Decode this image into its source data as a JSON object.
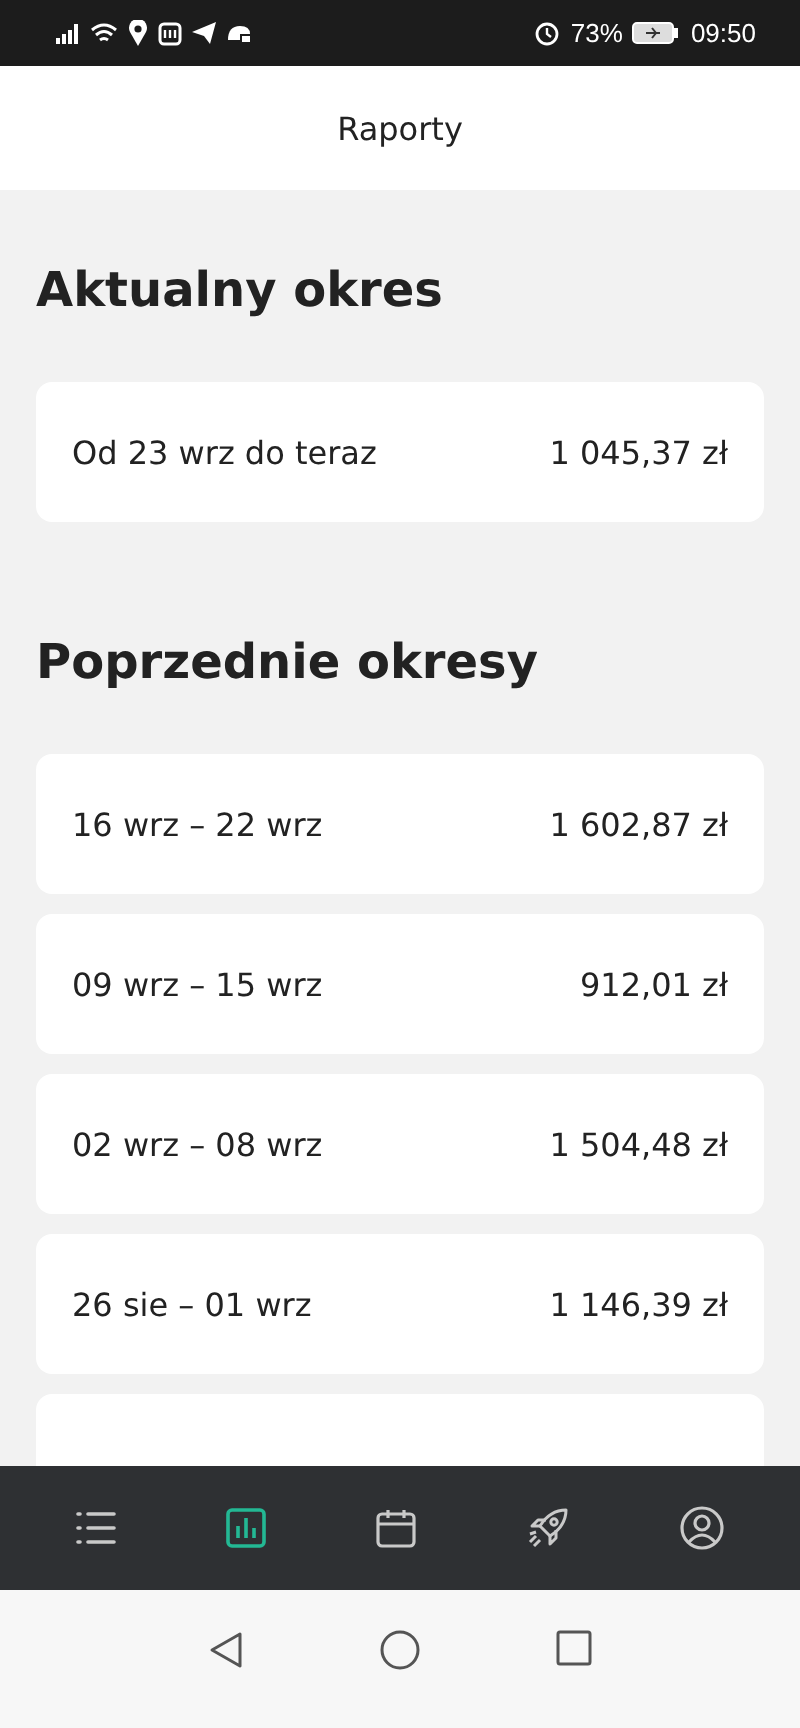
{
  "status_bar": {
    "battery": "73%",
    "time": "09:50"
  },
  "header": {
    "title": "Raporty"
  },
  "current": {
    "title": "Aktualny okres",
    "items": [
      {
        "label": "Od 23 wrz do teraz",
        "amount": "1 045,37 zł"
      }
    ]
  },
  "previous": {
    "title": "Poprzednie okresy",
    "items": [
      {
        "label": "16 wrz – 22 wrz",
        "amount": "1 602,87 zł"
      },
      {
        "label": "09 wrz – 15 wrz",
        "amount": "912,01 zł"
      },
      {
        "label": "02 wrz – 08 wrz",
        "amount": "1 504,48 zł"
      },
      {
        "label": "26 sie – 01 wrz",
        "amount": "1 146,39 zł"
      }
    ],
    "cut_off_card": true
  },
  "nav": {
    "items": [
      {
        "kind": "list",
        "selected": false
      },
      {
        "kind": "chart",
        "selected": true
      },
      {
        "kind": "calendar",
        "selected": false
      },
      {
        "kind": "rocket",
        "selected": false
      },
      {
        "kind": "profile",
        "selected": false
      }
    ]
  }
}
